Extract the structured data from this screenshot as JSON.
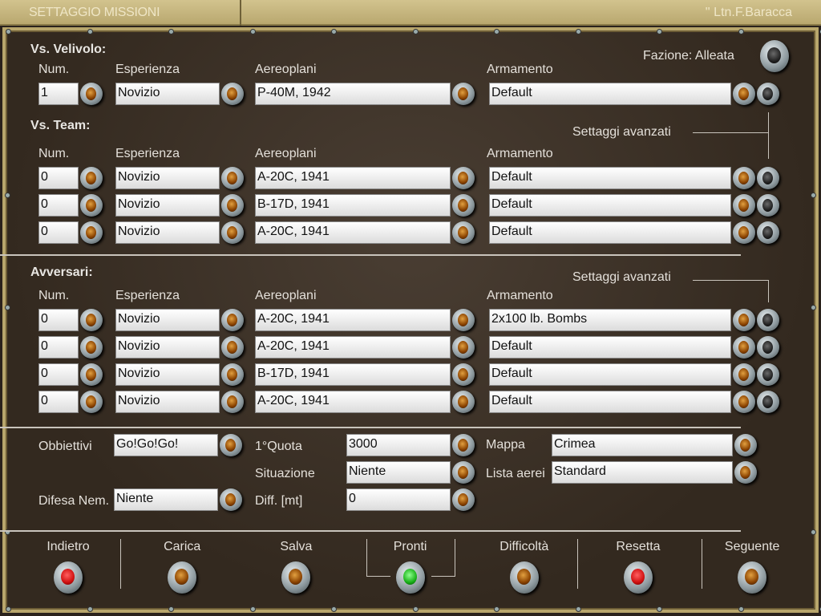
{
  "title": "SETTAGGIO MISSIONI",
  "user": "'' Ltn.F.Baracca",
  "headers": {
    "num": "Num.",
    "exp": "Esperienza",
    "plane": "Aereoplani",
    "arm": "Armamento"
  },
  "player": {
    "label": "Vs. Velivolo:",
    "faction": "Fazione: Alleata",
    "row": {
      "num": "1",
      "exp": "Novizio",
      "plane": "P-40M, 1942",
      "arm": "Default"
    }
  },
  "team": {
    "label": "Vs. Team:",
    "advanced": "Settaggi avanzati",
    "rows": [
      {
        "num": "0",
        "exp": "Novizio",
        "plane": "A-20C, 1941",
        "arm": "Default"
      },
      {
        "num": "0",
        "exp": "Novizio",
        "plane": "B-17D, 1941",
        "arm": "Default"
      },
      {
        "num": "0",
        "exp": "Novizio",
        "plane": "A-20C, 1941",
        "arm": "Default"
      }
    ]
  },
  "enemy": {
    "label": "Avversari:",
    "advanced": "Settaggi avanzati",
    "rows": [
      {
        "num": "0",
        "exp": "Novizio",
        "plane": "A-20C, 1941",
        "arm": "2x100 lb. Bombs"
      },
      {
        "num": "0",
        "exp": "Novizio",
        "plane": "A-20C, 1941",
        "arm": "Default"
      },
      {
        "num": "0",
        "exp": "Novizio",
        "plane": "B-17D, 1941",
        "arm": "Default"
      },
      {
        "num": "0",
        "exp": "Novizio",
        "plane": "A-20C, 1941",
        "arm": "Default"
      }
    ]
  },
  "settings": {
    "objectives_label": "Obbiettivi",
    "objectives": "Go!Go!Go!",
    "altitude_label": "1°Quota",
    "altitude": "3000",
    "map_label": "Mappa",
    "map": "Crimea",
    "situation_label": "Situazione",
    "situation": "Niente",
    "planelist_label": "Lista aerei",
    "planelist": "Standard",
    "defense_label": "Difesa Nem.",
    "defense": "Niente",
    "diff_label": "Diff. [mt]",
    "diff": "0"
  },
  "buttons": [
    {
      "label": "Indietro",
      "light": "red"
    },
    {
      "label": "Carica",
      "light": "amber"
    },
    {
      "label": "Salva",
      "light": "amber"
    },
    {
      "label": "Pronti",
      "light": "green"
    },
    {
      "label": "Difficoltà",
      "light": "amber"
    },
    {
      "label": "Resetta",
      "light": "red"
    },
    {
      "label": "Seguente",
      "light": "amber"
    }
  ]
}
